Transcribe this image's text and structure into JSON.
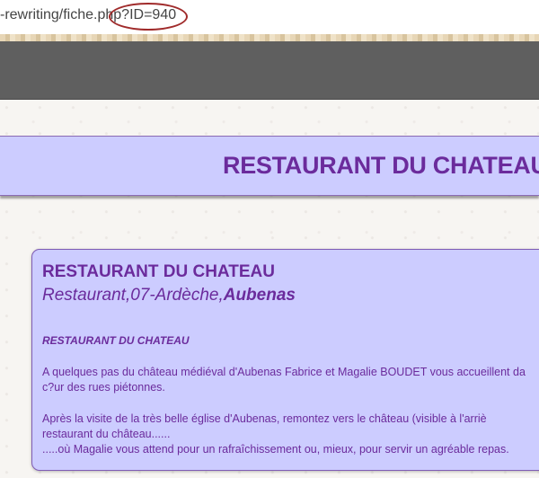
{
  "browser": {
    "url": "-rewriting/fiche.php?ID=940"
  },
  "banner": {
    "title": "RESTAURANT DU CHATEAU"
  },
  "fiche": {
    "name": "RESTAURANT DU CHATEAU",
    "subtitle_prefix": "Restaurant,07-Ardèche,",
    "subtitle_city": "Aubenas",
    "heading": "RESTAURANT DU CHATEAU",
    "p1_line1": "A quelques pas du château médiéval d'Aubenas Fabrice et Magalie  BOUDET vous accueillent da",
    "p1_line2": "c?ur des rues piétonnes.",
    "p2_line1": "Après la visite de la très belle église d'Aubenas, remontez vers le château  (visible à l'arriè",
    "p2_line2": "restaurant du château......",
    "p2_line3": ".....où Magalie vous attend pour un rafraîchissement ou, mieux, pour servir  un agréable repas."
  },
  "colors": {
    "accent": "#6b2b9c",
    "card_bg": "#ccccff",
    "annotation": "#a02b2b",
    "header_bar": "#5f5f5f"
  }
}
